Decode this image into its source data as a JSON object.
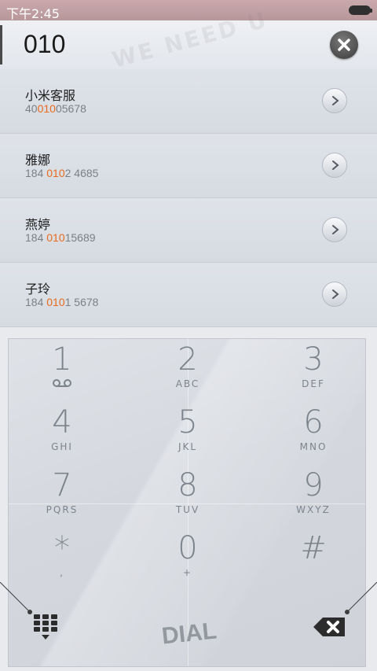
{
  "status_bar": {
    "time": "下午2:45"
  },
  "search": {
    "query": "010",
    "stamp_text": "WE NEED U"
  },
  "results": [
    {
      "name": "小米客服",
      "number_pre": "40",
      "number_match": "010",
      "number_post": "05678"
    },
    {
      "name": "雅娜",
      "number_pre": "184 ",
      "number_match": "010",
      "number_post": "2 4685"
    },
    {
      "name": "燕婷",
      "number_pre": "184 ",
      "number_match": "010",
      "number_post": "15689"
    },
    {
      "name": "子玲",
      "number_pre": "184 ",
      "number_match": "010",
      "number_post": "1 5678"
    }
  ],
  "keypad": {
    "keys": [
      {
        "digit": "1",
        "letters": ""
      },
      {
        "digit": "2",
        "letters": "ABC"
      },
      {
        "digit": "3",
        "letters": "DEF"
      },
      {
        "digit": "4",
        "letters": "GHI"
      },
      {
        "digit": "5",
        "letters": "JKL"
      },
      {
        "digit": "6",
        "letters": "MNO"
      },
      {
        "digit": "7",
        "letters": "PQRS"
      },
      {
        "digit": "8",
        "letters": "TUV"
      },
      {
        "digit": "9",
        "letters": "WXYZ"
      },
      {
        "digit": "*",
        "letters": ","
      },
      {
        "digit": "0",
        "letters": "+"
      },
      {
        "digit": "#",
        "letters": ""
      }
    ],
    "dial_label": "DIAL"
  },
  "colors": {
    "highlight": "#e96a1c",
    "digit": "#7d838b",
    "status_bar": "#c0a0a4"
  }
}
